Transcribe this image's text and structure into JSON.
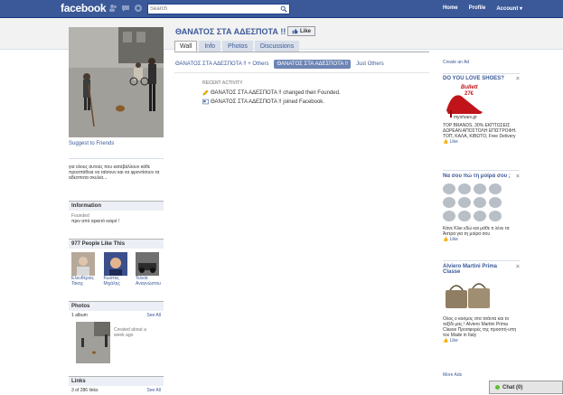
{
  "topbar": {
    "logo": "facebook",
    "search_placeholder": "Search",
    "nav": [
      "Home",
      "Profile",
      "Account ▾"
    ]
  },
  "left": {
    "suggest": "Suggest to Friends",
    "about": "για ολους αυτούς που καταβάλλουν κάθε προσπάθεια να ταϊσουν και να φροντίσουν τα αδέσποτα σκυλιά...",
    "info_head": "Information",
    "info_label": "Founded",
    "info_value": "πριν από αρκετό καιρό !",
    "people_head": "977 People Like This",
    "people": [
      "Ελευθέριος Τάκης",
      "Κώστας Μιχάλης",
      "Τελεία Αναγνώστου"
    ],
    "photos_head": "Photos",
    "album_count": "1 album",
    "see_all": "See All",
    "album_caption": "Created about a week ago",
    "links_head": "Links",
    "links_count": "3 of 286 links",
    "links_see_all": "See All"
  },
  "main": {
    "title": "ΘΑΝΑΤΟΣ ΣΤΑ ΑΔΕΣΠΟΤΑ !!",
    "like_label": "Like",
    "tabs": [
      "Wall",
      "Info",
      "Photos",
      "Discussions"
    ],
    "filters": [
      "ΘΑΝΑΤΟΣ ΣΤΑ ΑΔΕΣΠΟΤΑ !! + Others",
      "ΘΑΝΑΤΟΣ ΣΤΑ ΑΔΕΣΠΟΤΑ !!",
      "Just Others"
    ],
    "recent_head": "RECENT ACTIVITY",
    "activities": [
      "ΘΑΝΑΤΟΣ ΣΤΑ ΑΔΕΣΠΟΤΑ !! changed their Founded.",
      "ΘΑΝΑΤΟΣ ΣΤΑ ΑΔΕΣΠΟΤΑ !! joined Facebook."
    ]
  },
  "right": {
    "create_ad": "Create an Ad",
    "ad1_title": "DO YOU LOVE SHOES?",
    "ad1_brand": "Bullett",
    "ad1_price": "27€",
    "ad1_site": "myshoes.gr",
    "ad1_text": "TOP BRANDS, 30% ΕΚΠΤΩΣΕΙΣ ΔΩΡΕΑΝ ΑΠΟΣΤΟΛΗ ΕΠΙΣΤΡΟΦΗ. ΤΟΠ, ΚΑΛΑ, ΚΙΒΩΤΟ, Free Delivery",
    "ad2_title": "Να σου πώ τη μοίρα σου ;",
    "ad2_text": "Κάνε Κλικ εδώ και μάθε τι λένε τα Άστρα για τη μοίρα σου",
    "ad3_title": "Alviero Martini Prima Classe",
    "ad3_text": "Ολος ο κόσμος στα τσάντα και το ταξίδι μας ! Alviero Martini Prima Classe Προσφορές της προσιτή-υπη του Made in Italy",
    "like": "Like",
    "more_ads": "More Ads"
  },
  "chat": {
    "label": "Chat (0)"
  }
}
